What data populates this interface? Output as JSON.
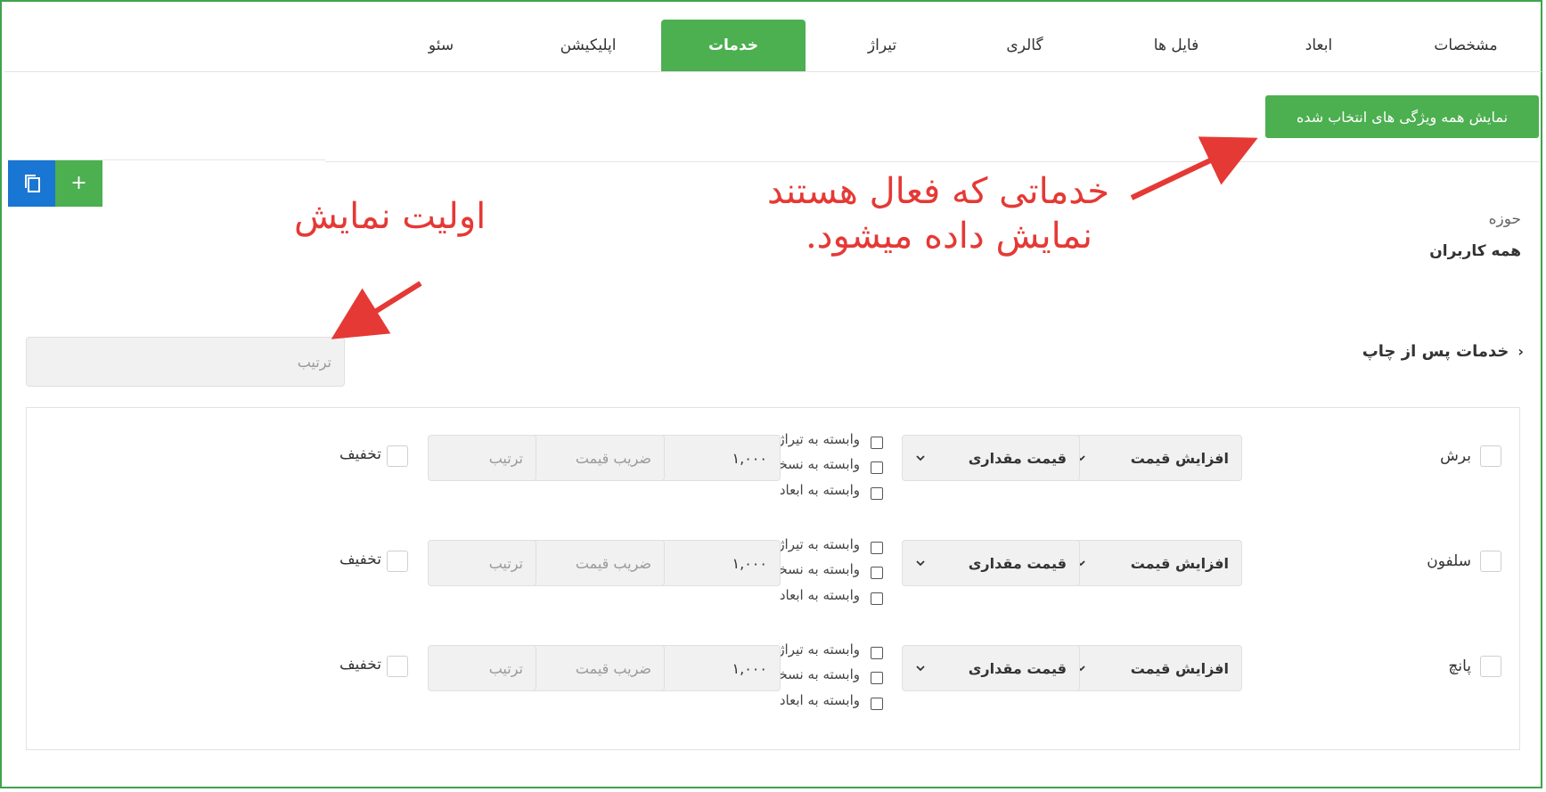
{
  "tabs": [
    {
      "label": "مشخصات",
      "active": false
    },
    {
      "label": "ابعاد",
      "active": false
    },
    {
      "label": "فایل ها",
      "active": false
    },
    {
      "label": "گالری",
      "active": false
    },
    {
      "label": "تیراژ",
      "active": false
    },
    {
      "label": "خدمات",
      "active": true
    },
    {
      "label": "اپلیکیشن",
      "active": false
    },
    {
      "label": "سئو",
      "active": false
    }
  ],
  "show_all_button": "نمایش همه ویژگی های انتخاب شده",
  "scope": {
    "label": "حوزه",
    "value": "همه کاربران"
  },
  "section_title": "خدمات پس از چاپ",
  "order_placeholder": "ترتیب",
  "toolbar": {
    "add_icon": "plus-icon",
    "copy_icon": "copy-icon"
  },
  "annotations": {
    "services_active": [
      "خدماتی که فعال هستند",
      "نمایش داده میشود."
    ],
    "display_priority": "اولیت نمایش"
  },
  "services": [
    {
      "name": "برش",
      "mode": "افزایش قیمت",
      "price_type": "قیمت مقداری",
      "options": [
        "وابسته به تیراژ",
        "وابسته به نسخه",
        "وابسته به ابعاد"
      ],
      "amount": "۱,۰۰۰",
      "factor_placeholder": "ضریب قیمت",
      "order_placeholder": "ترتیب",
      "discount_label": "تخفیف"
    },
    {
      "name": "سلفون",
      "mode": "افزایش قیمت",
      "price_type": "قیمت مقداری",
      "options": [
        "وابسته به تیراژ",
        "وابسته به نسخه",
        "وابسته به ابعاد"
      ],
      "amount": "۱,۰۰۰",
      "factor_placeholder": "ضریب قیمت",
      "order_placeholder": "ترتیب",
      "discount_label": "تخفیف"
    },
    {
      "name": "پانچ",
      "mode": "افزایش قیمت",
      "price_type": "قیمت مقداری",
      "options": [
        "وابسته به تیراژ",
        "وابسته به نسخه",
        "وابسته به ابعاد"
      ],
      "amount": "۱,۰۰۰",
      "factor_placeholder": "ضریب قیمت",
      "order_placeholder": "ترتیب",
      "discount_label": "تخفیف"
    }
  ],
  "colors": {
    "accent_green": "#4caf50",
    "blue": "#1976d2",
    "annotation_red": "#e53935"
  }
}
